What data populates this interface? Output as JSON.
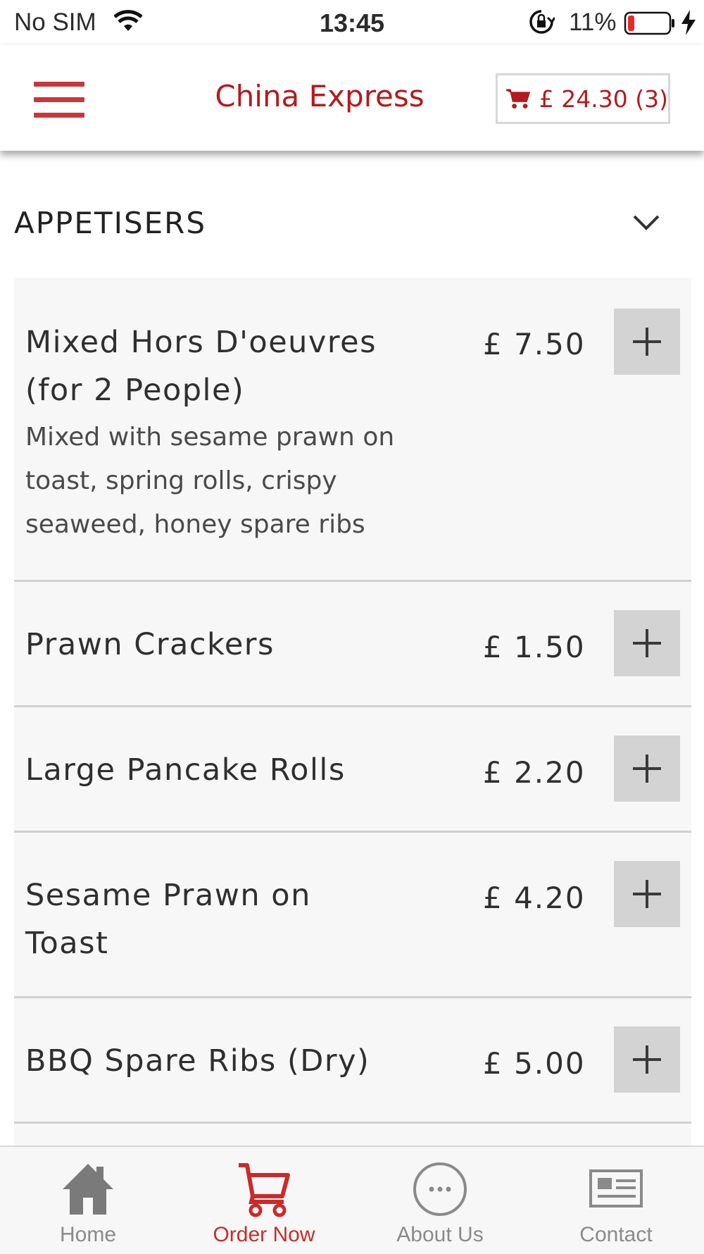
{
  "status_bar": {
    "carrier": "No SIM",
    "time": "13:45",
    "battery_percent": "11%"
  },
  "header": {
    "title": "China Express",
    "cart_label": "£ 24.30 (3)",
    "accent_color": "#b51a1e"
  },
  "category": {
    "title": "APPETISERS"
  },
  "items": [
    {
      "name": "Mixed Hors D'oeuvres (for 2 People)",
      "description": "Mixed with sesame prawn on toast, spring rolls, crispy seaweed, honey spare ribs",
      "price": "£ 7.50"
    },
    {
      "name": "Prawn Crackers",
      "description": "",
      "price": "£ 1.50"
    },
    {
      "name": "Large Pancake Rolls",
      "description": "",
      "price": "£ 2.20"
    },
    {
      "name": "Sesame Prawn on Toast",
      "description": "",
      "price": "£ 4.20"
    },
    {
      "name": "BBQ Spare Ribs (Dry)",
      "description": "",
      "price": "£ 5.00"
    }
  ],
  "tabs": [
    {
      "label": "Home",
      "icon": "home-icon"
    },
    {
      "label": "Order Now",
      "icon": "cart-icon",
      "active": true
    },
    {
      "label": "About Us",
      "icon": "more-dots-icon"
    },
    {
      "label": "Contact",
      "icon": "contact-card-icon"
    }
  ]
}
